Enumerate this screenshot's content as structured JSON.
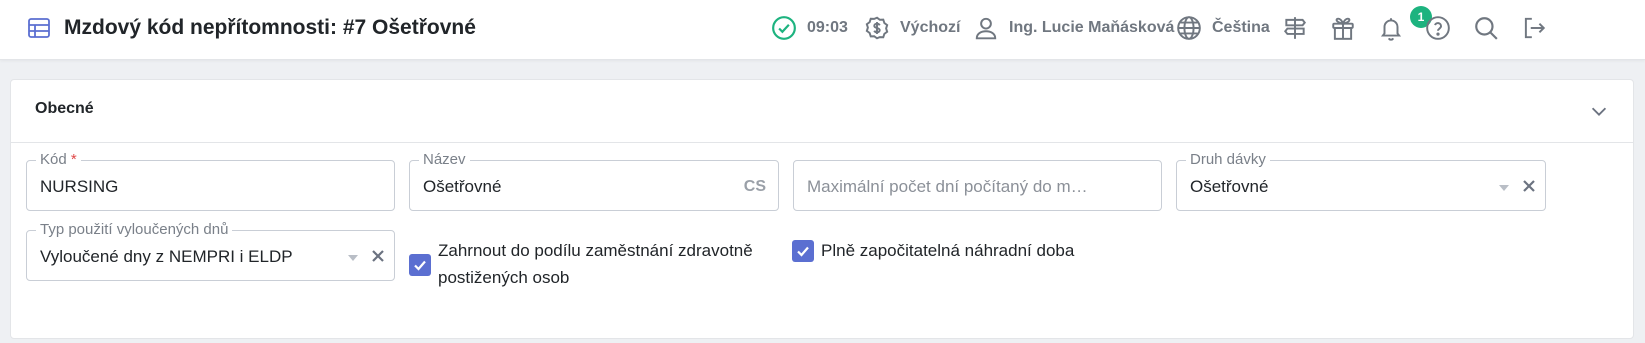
{
  "header": {
    "title": "Mzdový kód nepřítomnosti: #7 Ošetřovné",
    "time": "09:03",
    "currency_label": "Výchozí",
    "user_name": "Ing. Lucie Maňásková",
    "language": "Čeština",
    "gift_count": "1",
    "icons": [
      "menu-icon",
      "check-circle-icon",
      "currency-icon",
      "user-icon",
      "globe-icon",
      "signpost-icon",
      "gift-icon",
      "bell-icon",
      "help-icon",
      "search-icon",
      "logout-icon"
    ],
    "accent_color": "#5b6fd1",
    "success_color": "#1db37f"
  },
  "section": {
    "title": "Obecné"
  },
  "form": {
    "code": {
      "label": "Kód",
      "required_mark": "*",
      "value": "NURSING"
    },
    "name": {
      "label": "Název",
      "value": "Ošetřovné",
      "lang": "CS"
    },
    "max_days": {
      "placeholder": "Maximální počet dní počítaný do m…"
    },
    "benefit_type": {
      "label": "Druh dávky",
      "value": "Ošetřovné"
    },
    "excluded_days_type": {
      "label": "Typ použití vyloučených dnů",
      "value": "Vyloučené dny z NEMPRI i ELDP"
    },
    "include_disabled": {
      "label_line1": "Zahrnout do podílu zaměstnání zdravotně",
      "label_line2": "postižených osob",
      "checked": true
    },
    "fully_creditable": {
      "label": "Plně započitatelná náhradní doba",
      "checked": true
    }
  }
}
